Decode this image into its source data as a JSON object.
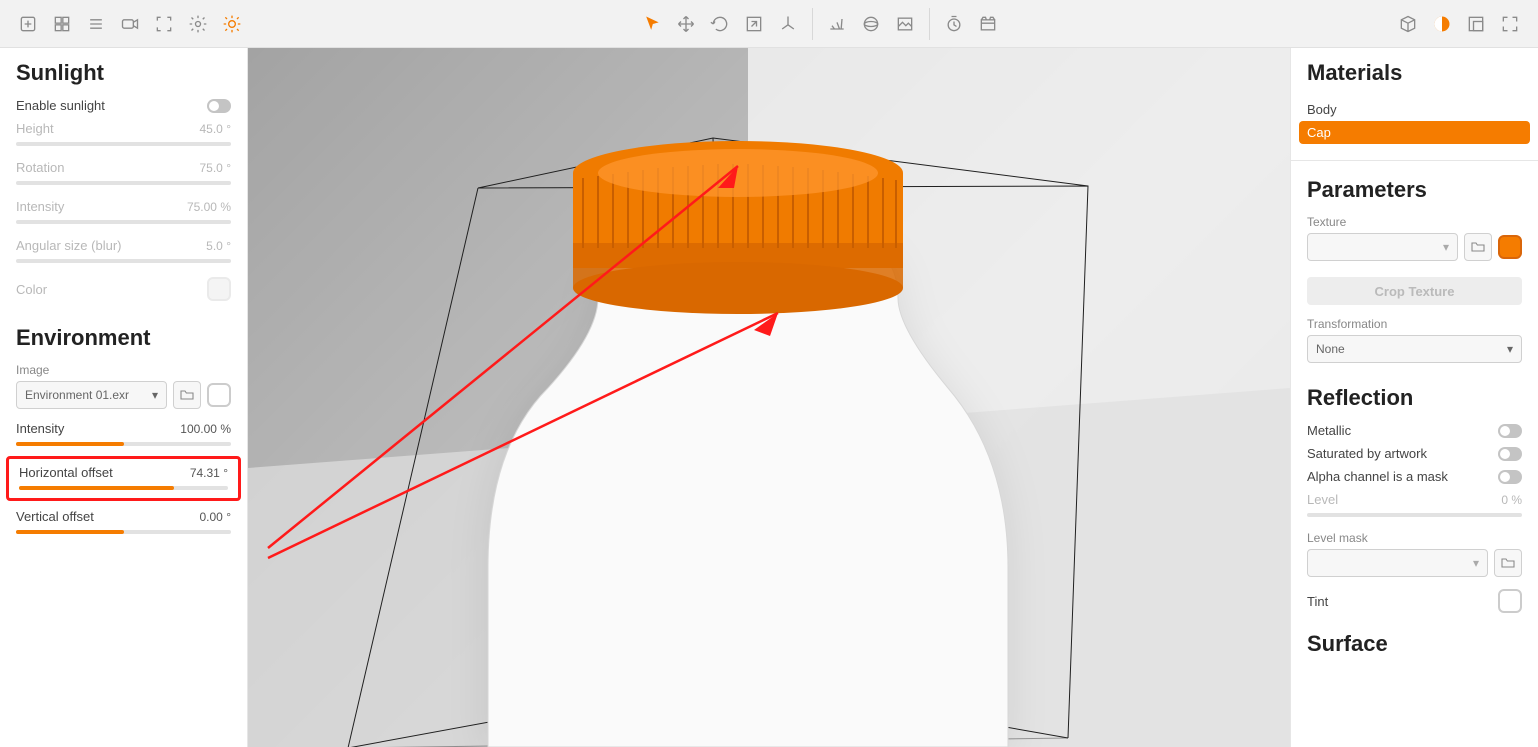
{
  "toolbar": {
    "left": [
      "add",
      "grid",
      "list",
      "camera",
      "focus",
      "gear",
      "sun"
    ],
    "center_a": [
      "pointer",
      "move",
      "rotate",
      "scale",
      "axis"
    ],
    "center_b": [
      "ground",
      "sphere",
      "image"
    ],
    "center_c": [
      "time",
      "clapper"
    ],
    "right": [
      "cube",
      "checker",
      "window",
      "fullscreen"
    ],
    "active_left": "sun",
    "active_center": "pointer",
    "active_right": "checker"
  },
  "sunlight": {
    "title": "Sunlight",
    "enable_label": "Enable sunlight",
    "enable": false,
    "height_label": "Height",
    "height_value": "45.0 °",
    "rotation_label": "Rotation",
    "rotation_value": "75.0 °",
    "intensity_label": "Intensity",
    "intensity_value": "75.00 %",
    "angular_label": "Angular size (blur)",
    "angular_value": "5.0 °",
    "color_label": "Color"
  },
  "environment": {
    "title": "Environment",
    "image_label": "Image",
    "image_value": "Environment 01.exr",
    "intensity_label": "Intensity",
    "intensity_value": "100.00 %",
    "intensity_pct": 50,
    "hoff_label": "Horizontal offset",
    "hoff_value": "74.31 °",
    "hoff_pct": 74,
    "voff_label": "Vertical offset",
    "voff_value": "0.00 °",
    "voff_pct": 50
  },
  "materials": {
    "title": "Materials",
    "items": [
      "Body",
      "Cap"
    ],
    "selected": "Cap"
  },
  "parameters": {
    "title": "Parameters",
    "texture_label": "Texture",
    "crop_label": "Crop Texture",
    "transformation_label": "Transformation",
    "transformation_value": "None",
    "color": "#f57c00"
  },
  "reflection": {
    "title": "Reflection",
    "metallic_label": "Metallic",
    "metallic": false,
    "sat_label": "Saturated by artwork",
    "sat": false,
    "alpha_label": "Alpha channel is a mask",
    "alpha": false,
    "level_label": "Level",
    "level_value": "0 %",
    "mask_label": "Level mask",
    "tint_label": "Tint"
  },
  "surface": {
    "title": "Surface"
  }
}
